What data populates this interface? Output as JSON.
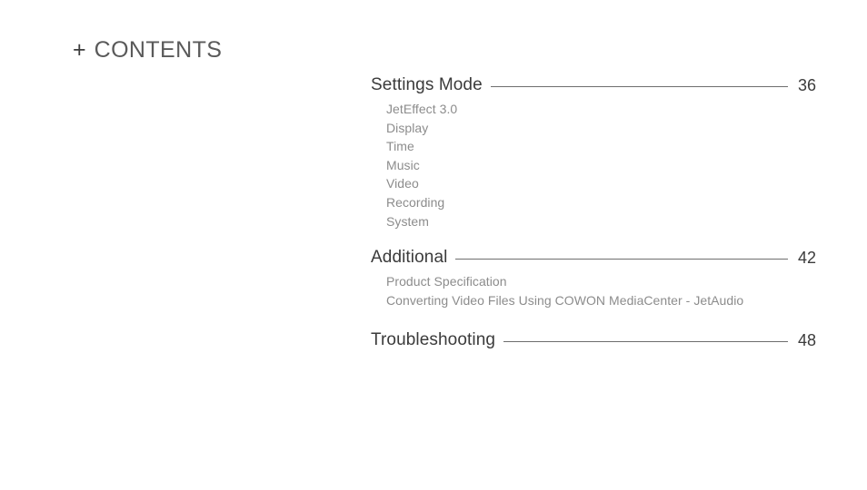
{
  "header": {
    "plus_glyph": "+",
    "title": "CONTENTS"
  },
  "colors": {
    "background": "#ffffff",
    "header_title": "#5a5a5a",
    "header_plus": "#3d3d3d",
    "section_title": "#3b3b3b",
    "page_number": "#3b3b3b",
    "sub_item": "#8c8c8c",
    "leader_line": "#6e6e6e"
  },
  "toc": {
    "sections": [
      {
        "title": "Settings Mode",
        "page": "36",
        "items": [
          "JetEffect 3.0",
          "Display",
          "Time",
          "Music",
          "Video",
          "Recording",
          "System"
        ]
      },
      {
        "title": "Additional",
        "page": "42",
        "items": [
          "Product Specification",
          "Converting Video Files Using COWON MediaCenter - JetAudio"
        ]
      },
      {
        "title": "Troubleshooting",
        "page": "48",
        "items": []
      }
    ]
  }
}
